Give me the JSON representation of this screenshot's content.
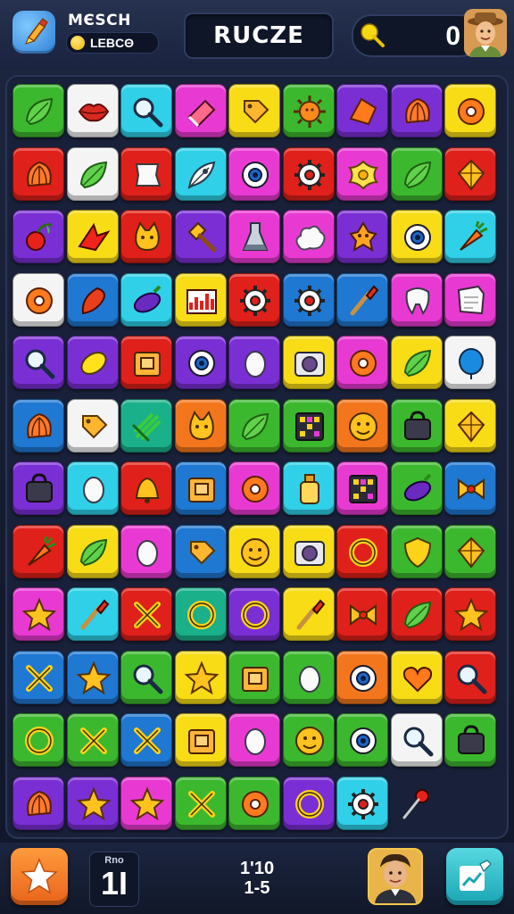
{
  "header": {
    "title": "MЄSCH",
    "coin_label": "LEBCΘ",
    "center_title": "RUCZE",
    "score": "0"
  },
  "footer": {
    "level_label": "Rno",
    "level_value": "1I",
    "moves_top": "1'10",
    "moves_bottom": "1-5"
  },
  "colors": {
    "green": "#3cb82e",
    "white": "#f4f4f4",
    "cyan": "#2fd0e8",
    "magenta": "#e83ad2",
    "yellow": "#f7dc16",
    "purple": "#7a2fd4",
    "red": "#e0201a",
    "blue": "#1f78d2",
    "orange": "#f4761c",
    "teal": "#1ab08a"
  },
  "board": {
    "rows": [
      [
        [
          "green",
          "leaf-icon"
        ],
        [
          "white",
          "lips-icon"
        ],
        [
          "cyan",
          "magnifier-icon"
        ],
        [
          "magenta",
          "eraser-icon"
        ],
        [
          "yellow",
          "tag-icon"
        ],
        [
          "green",
          "sun-gear-icon"
        ],
        [
          "purple",
          "shard-icon"
        ],
        [
          "purple",
          "shell-icon"
        ],
        [
          "yellow",
          "donut-icon"
        ]
      ],
      [
        [
          "red",
          "shell-icon"
        ],
        [
          "white",
          "leaf-icon"
        ],
        [
          "red",
          "cloth-icon"
        ],
        [
          "cyan",
          "feather-icon"
        ],
        [
          "magenta",
          "eye-icon"
        ],
        [
          "red",
          "gear-icon"
        ],
        [
          "magenta",
          "flower-icon"
        ],
        [
          "green",
          "leaf-icon"
        ],
        [
          "red",
          "gem-icon"
        ]
      ],
      [
        [
          "purple",
          "cherry-icon"
        ],
        [
          "yellow",
          "bird-icon"
        ],
        [
          "red",
          "cat-icon"
        ],
        [
          "purple",
          "hammer-icon"
        ],
        [
          "magenta",
          "flask-icon"
        ],
        [
          "magenta",
          "cloud-icon"
        ],
        [
          "purple",
          "mask-icon"
        ],
        [
          "yellow",
          "eye-icon"
        ],
        [
          "cyan",
          "carrot-icon"
        ]
      ],
      [
        [
          "white",
          "donut-icon"
        ],
        [
          "blue",
          "chili-icon"
        ],
        [
          "cyan",
          "eggplant-icon"
        ],
        [
          "yellow",
          "chart-icon"
        ],
        [
          "red",
          "gear-icon"
        ],
        [
          "blue",
          "gear-icon"
        ],
        [
          "blue",
          "brush-icon"
        ],
        [
          "magenta",
          "tooth-icon"
        ],
        [
          "magenta",
          "paper-icon"
        ]
      ],
      [
        [
          "purple",
          "magnifier-icon"
        ],
        [
          "purple",
          "lemon-icon"
        ],
        [
          "red",
          "box-icon"
        ],
        [
          "purple",
          "eye-icon"
        ],
        [
          "purple",
          "egg-icon"
        ],
        [
          "yellow",
          "camera-icon"
        ],
        [
          "magenta",
          "donut-icon"
        ],
        [
          "yellow",
          "leaf-icon"
        ],
        [
          "white",
          "balloon-icon"
        ]
      ],
      [
        [
          "blue",
          "shell-icon"
        ],
        [
          "white",
          "tag-icon"
        ],
        [
          "teal",
          "bamboo-icon"
        ],
        [
          "orange",
          "cat-icon"
        ],
        [
          "green",
          "leaf-icon"
        ],
        [
          "green",
          "grid-icon"
        ],
        [
          "orange",
          "face-icon"
        ],
        [
          "green",
          "bag-icon"
        ],
        [
          "yellow",
          "gem-icon"
        ]
      ],
      [
        [
          "purple",
          "bag-icon"
        ],
        [
          "cyan",
          "egg-icon"
        ],
        [
          "red",
          "bell-icon"
        ],
        [
          "blue",
          "box-icon"
        ],
        [
          "magenta",
          "donut-icon"
        ],
        [
          "cyan",
          "bottle-icon"
        ],
        [
          "magenta",
          "grid-icon"
        ],
        [
          "green",
          "eggplant-icon"
        ],
        [
          "blue",
          "bow-icon"
        ]
      ],
      [
        [
          "red",
          "carrot-icon"
        ],
        [
          "yellow",
          "leaf-icon"
        ],
        [
          "magenta",
          "egg-icon"
        ],
        [
          "blue",
          "tag-icon"
        ],
        [
          "yellow",
          "face-icon"
        ],
        [
          "yellow",
          "camera-icon"
        ],
        [
          "red",
          "ring-icon"
        ],
        [
          "green",
          "shield-icon"
        ],
        [
          "green",
          "gem-icon"
        ]
      ],
      [
        [
          "magenta",
          "star-icon"
        ],
        [
          "cyan",
          "brush-icon"
        ],
        [
          "red",
          "x-icon"
        ],
        [
          "teal",
          "ring-icon"
        ],
        [
          "purple",
          "ring-icon"
        ],
        [
          "yellow",
          "brush-icon"
        ],
        [
          "red",
          "bow-icon"
        ],
        [
          "red",
          "leaf-icon"
        ],
        [
          "red",
          "star-icon"
        ]
      ],
      [
        [
          "blue",
          "x-icon"
        ],
        [
          "blue",
          "star-icon"
        ],
        [
          "green",
          "magnifier-icon"
        ],
        [
          "yellow",
          "star-icon"
        ],
        [
          "green",
          "box-icon"
        ],
        [
          "green",
          "egg-icon"
        ],
        [
          "orange",
          "eye-icon"
        ],
        [
          "yellow",
          "heart-icon"
        ],
        [
          "red",
          "magnifier-icon"
        ]
      ],
      [
        [
          "green",
          "ring-icon"
        ],
        [
          "green",
          "x-icon"
        ],
        [
          "blue",
          "x-icon"
        ],
        [
          "yellow",
          "box-icon"
        ],
        [
          "magenta",
          "egg-icon"
        ],
        [
          "green",
          "face-icon"
        ],
        [
          "green",
          "eye-icon"
        ],
        [
          "white",
          "magnifier-icon"
        ],
        [
          "green",
          "bag-icon"
        ]
      ],
      [
        [
          "purple",
          "shell-icon"
        ],
        [
          "purple",
          "star-icon"
        ],
        [
          "magenta",
          "star-icon"
        ],
        [
          "green",
          "x-icon"
        ],
        [
          "green",
          "donut-icon"
        ],
        [
          "purple",
          "ring-icon"
        ],
        [
          "cyan",
          "gear-icon"
        ],
        [
          null,
          "pin-icon"
        ]
      ]
    ]
  }
}
